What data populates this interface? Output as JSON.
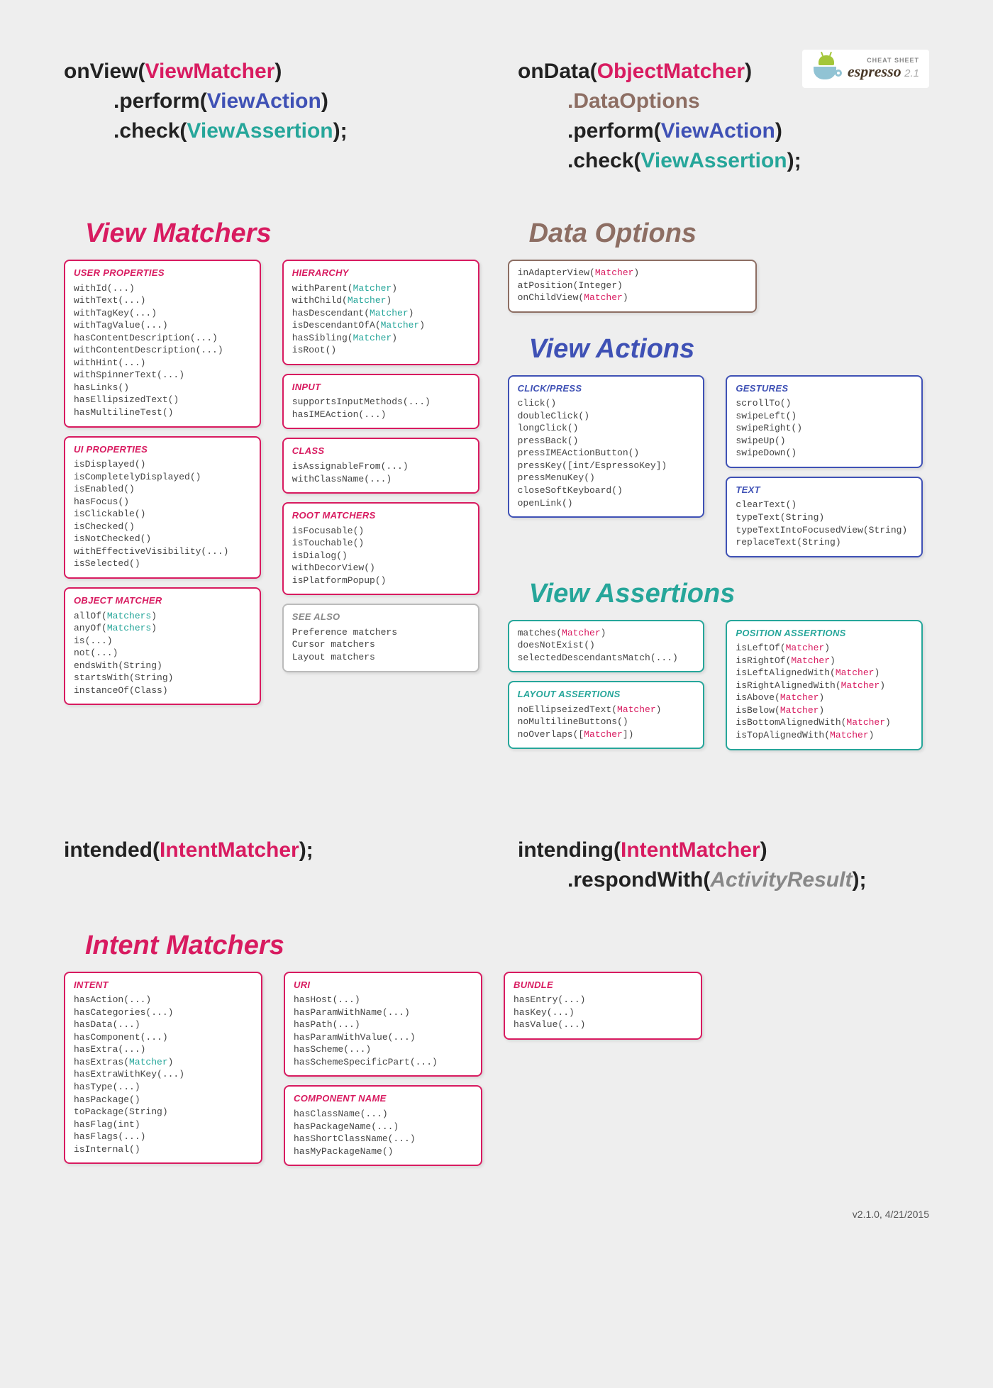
{
  "logo": {
    "small": "CHEAT SHEET",
    "name": "espresso",
    "version": "2.1"
  },
  "syntax": {
    "onView": {
      "fn": "onView",
      "arg": "ViewMatcher",
      "l2_fn": ".perform",
      "l2_arg": "ViewAction",
      "l3_fn": ".check",
      "l3_arg": "ViewAssertion"
    },
    "onData": {
      "fn": "onData",
      "arg": "ObjectMatcher",
      "l2": ".DataOptions",
      "l3_fn": ".perform",
      "l3_arg": "ViewAction",
      "l4_fn": ".check",
      "l4_arg": "ViewAssertion"
    },
    "intended": {
      "fn": "intended",
      "arg": "IntentMatcher"
    },
    "intending": {
      "fn": "intending",
      "arg": "IntentMatcher",
      "l2_fn": ".respondWith",
      "l2_arg": "ActivityResult"
    }
  },
  "sections": {
    "viewMatchers": "View Matchers",
    "dataOptions": "Data Options",
    "viewActions": "View Actions",
    "viewAssertions": "View Assertions",
    "intentMatchers": "Intent Matchers"
  },
  "boxes": {
    "userProperties": {
      "title": "USER PROPERTIES",
      "items": [
        "withId(...)",
        "withText(...)",
        "withTagKey(...)",
        "withTagValue(...)",
        "hasContentDescription(...)",
        "withContentDescription(...)",
        "withHint(...)",
        "withSpinnerText(...)",
        "hasLinks()",
        "hasEllipsizedText()",
        "hasMultilineTest()"
      ]
    },
    "uiProperties": {
      "title": "UI PROPERTIES",
      "items": [
        "isDisplayed()",
        "isCompletelyDisplayed()",
        "isEnabled()",
        "hasFocus()",
        "isClickable()",
        "isChecked()",
        "isNotChecked()",
        "withEffectiveVisibility(...)",
        "isSelected()"
      ]
    },
    "objectMatcher": {
      "title": "OBJECT MATCHER",
      "items": [
        {
          "pre": "allOf(",
          "arg": "Matchers",
          "post": ")"
        },
        {
          "pre": "anyOf(",
          "arg": "Matchers",
          "post": ")"
        },
        "is(...)",
        "not(...)",
        "endsWith(String)",
        "startsWith(String)",
        "instanceOf(Class)"
      ]
    },
    "hierarchy": {
      "title": "HIERARCHY",
      "items": [
        {
          "pre": "withParent(",
          "arg": "Matcher",
          "post": ")"
        },
        {
          "pre": "withChild(",
          "arg": "Matcher",
          "post": ")"
        },
        {
          "pre": "hasDescendant(",
          "arg": "Matcher",
          "post": ")"
        },
        {
          "pre": "isDescendantOfA(",
          "arg": "Matcher",
          "post": ")"
        },
        {
          "pre": "hasSibling(",
          "arg": "Matcher",
          "post": ")"
        },
        "isRoot()"
      ]
    },
    "input": {
      "title": "INPUT",
      "items": [
        "supportsInputMethods(...)",
        "hasIMEAction(...)"
      ]
    },
    "class": {
      "title": "CLASS",
      "items": [
        "isAssignableFrom(...)",
        "withClassName(...)"
      ]
    },
    "rootMatchers": {
      "title": "ROOT MATCHERS",
      "items": [
        "isFocusable()",
        "isTouchable()",
        "isDialog()",
        "withDecorView()",
        "isPlatformPopup()"
      ]
    },
    "seeAlso": {
      "title": "SEE ALSO",
      "items": [
        "Preference matchers",
        "Cursor matchers",
        "Layout matchers"
      ]
    },
    "dataOptionsBox": {
      "items": [
        {
          "pre": "inAdapterView(",
          "arg": "Matcher",
          "post": ")"
        },
        "atPosition(Integer)",
        {
          "pre": "onChildView(",
          "arg": "Matcher",
          "post": ")"
        }
      ]
    },
    "clickPress": {
      "title": "CLICK/PRESS",
      "items": [
        "click()",
        "doubleClick()",
        "longClick()",
        "pressBack()",
        "pressIMEActionButton()",
        "pressKey([int/EspressoKey])",
        "pressMenuKey()",
        "closeSoftKeyboard()",
        "openLink()"
      ]
    },
    "gestures": {
      "title": "GESTURES",
      "items": [
        "scrollTo()",
        "swipeLeft()",
        "swipeRight()",
        "swipeUp()",
        "swipeDown()"
      ]
    },
    "text": {
      "title": "TEXT",
      "items": [
        "clearText()",
        "typeText(String)",
        "typeTextIntoFocusedView(String)",
        "replaceText(String)"
      ]
    },
    "assertMain": {
      "items": [
        {
          "pre": "matches(",
          "arg": "Matcher",
          "post": ")"
        },
        "doesNotExist()",
        "selectedDescendantsMatch(...)"
      ]
    },
    "layoutAssertions": {
      "title": "LAYOUT ASSERTIONS",
      "items": [
        {
          "pre": "noEllipseizedText(",
          "arg": "Matcher",
          "post": ")"
        },
        "noMultilineButtons()",
        {
          "pre": "noOverlaps([",
          "arg": "Matcher",
          "post": "])"
        }
      ]
    },
    "positionAssertions": {
      "title": "POSITION ASSERTIONS",
      "items": [
        {
          "pre": "isLeftOf(",
          "arg": "Matcher",
          "post": ")"
        },
        {
          "pre": "isRightOf(",
          "arg": "Matcher",
          "post": ")"
        },
        {
          "pre": "isLeftAlignedWith(",
          "arg": "Matcher",
          "post": ")"
        },
        {
          "pre": "isRightAlignedWith(",
          "arg": "Matcher",
          "post": ")"
        },
        {
          "pre": "isAbove(",
          "arg": "Matcher",
          "post": ")"
        },
        {
          "pre": "isBelow(",
          "arg": "Matcher",
          "post": ")"
        },
        {
          "pre": "isBottomAlignedWith(",
          "arg": "Matcher",
          "post": ")"
        },
        {
          "pre": "isTopAlignedWith(",
          "arg": "Matcher",
          "post": ")"
        }
      ]
    },
    "intent": {
      "title": "INTENT",
      "items": [
        "hasAction(...)",
        "hasCategories(...)",
        "hasData(...)",
        "hasComponent(...)",
        "hasExtra(...)",
        {
          "pre": "hasExtras(",
          "arg": "Matcher",
          "post": ")"
        },
        "hasExtraWithKey(...)",
        "hasType(...)",
        "hasPackage()",
        "toPackage(String)",
        "hasFlag(int)",
        "hasFlags(...)",
        "isInternal()"
      ]
    },
    "uri": {
      "title": "URI",
      "items": [
        "hasHost(...)",
        "hasParamWithName(...)",
        "hasPath(...)",
        "hasParamWithValue(...)",
        "hasScheme(...)",
        "hasSchemeSpecificPart(...)"
      ]
    },
    "componentName": {
      "title": "COMPONENT NAME",
      "items": [
        "hasClassName(...)",
        "hasPackageName(...)",
        "hasShortClassName(...)",
        "hasMyPackageName()"
      ]
    },
    "bundle": {
      "title": "BUNDLE",
      "items": [
        "hasEntry(...)",
        "hasKey(...)",
        "hasValue(...)"
      ]
    }
  },
  "footer": "v2.1.0, 4/21/2015"
}
